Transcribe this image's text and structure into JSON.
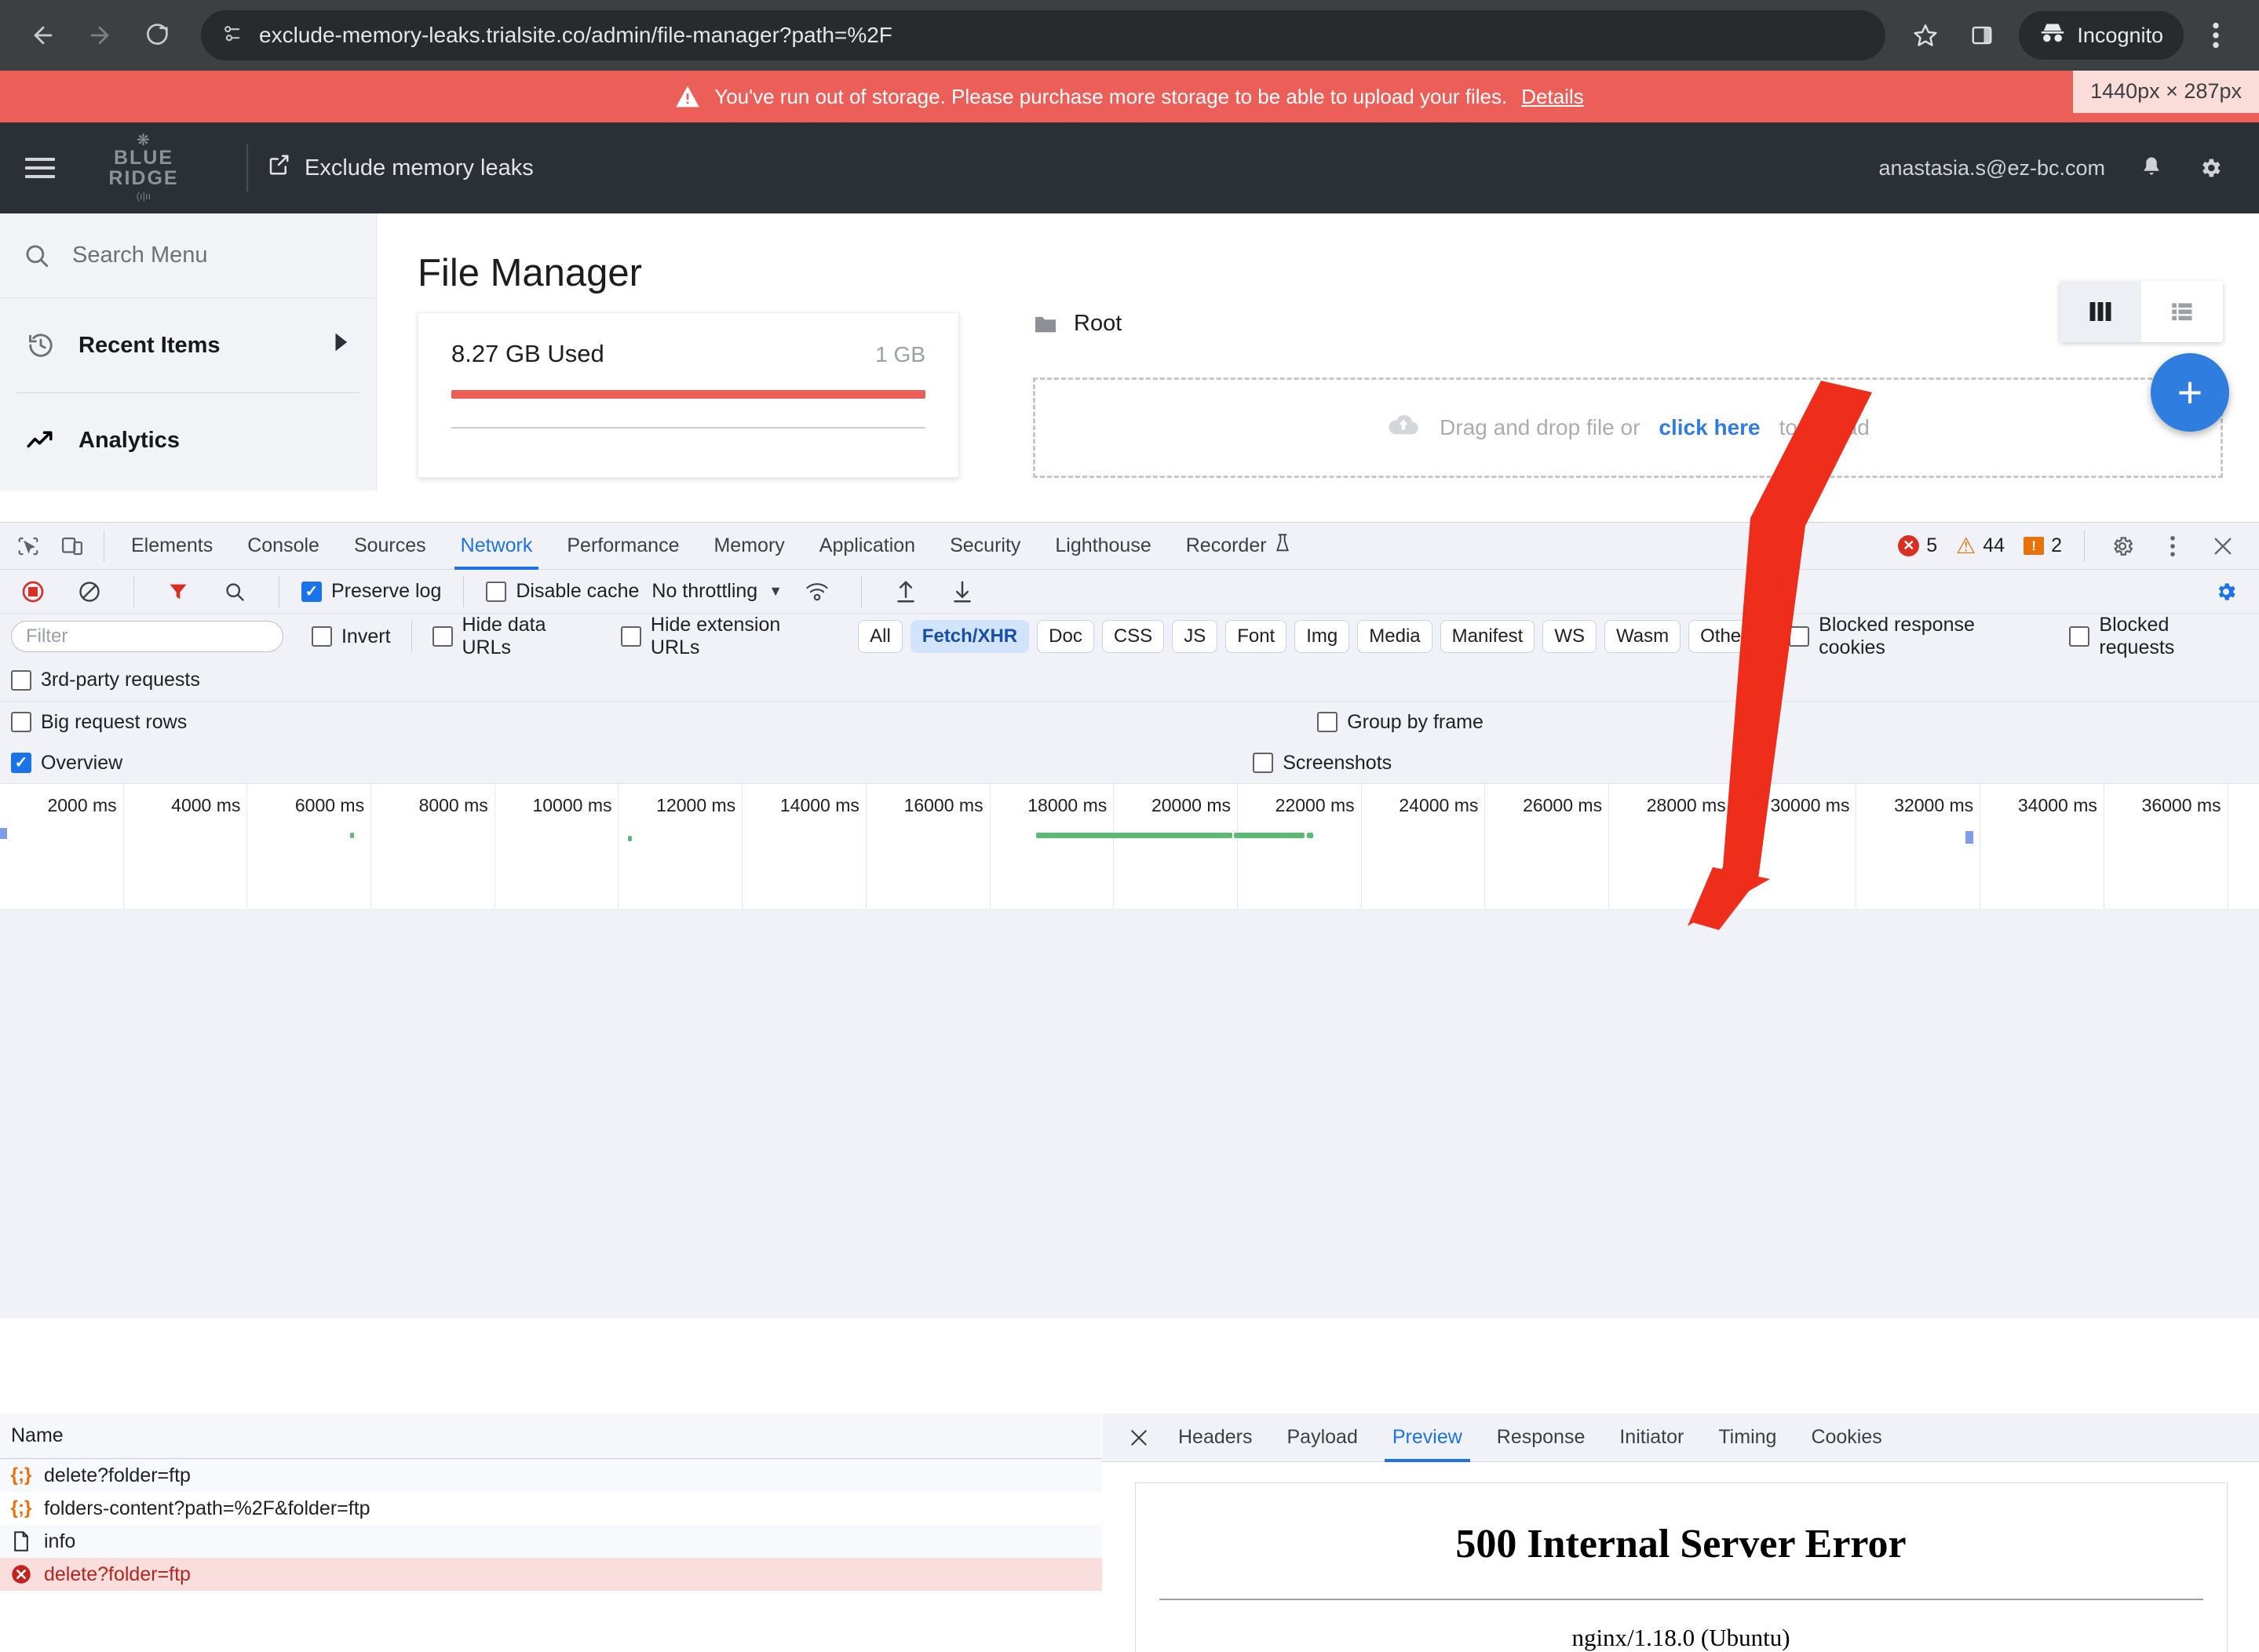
{
  "browser": {
    "url": "exclude-memory-leaks.trialsite.co/admin/file-manager?path=%2F",
    "back_label": "Back",
    "forward_label": "Forward",
    "reload_label": "Reload",
    "bookmark_label": "Bookmark this tab",
    "side_panel_label": "Side panel",
    "incognito_label": "Incognito",
    "menu_label": "Customize and control Chrome"
  },
  "storage_banner": {
    "message": "You've run out of storage. Please purchase more storage to be able to upload your files.",
    "link": "Details",
    "viewport_badge": "1440px × 287px",
    "background": "#ec5f59"
  },
  "app_header": {
    "brand_line1": "BLUE",
    "brand_line2": "RIDGE",
    "brand_sub": "(ı|ıı",
    "app_name": "Exclude memory leaks",
    "user_email": "anastasia.s@ez-bc.com"
  },
  "sidebar": {
    "search_placeholder": "Search Menu",
    "items": [
      {
        "label": "Recent Items",
        "icon": "history-icon",
        "has_caret": true
      },
      {
        "label": "Analytics",
        "icon": "trending-up-icon",
        "has_caret": false
      }
    ]
  },
  "file_manager": {
    "title": "File Manager",
    "storage": {
      "used_label": "8.27 GB Used",
      "total_label": "1 GB",
      "bar_percent": 100,
      "bar_color": "#ec5f59"
    },
    "breadcrumb": "Root",
    "dropzone": {
      "text_before": "Drag and drop file or",
      "link": "click here",
      "text_after": "to upload"
    },
    "view_grid_label": "Grid view",
    "view_list_label": "List view",
    "add_button_label": "+"
  },
  "devtools": {
    "tabs": [
      {
        "label": "Elements",
        "active": false
      },
      {
        "label": "Console",
        "active": false
      },
      {
        "label": "Sources",
        "active": false
      },
      {
        "label": "Network",
        "active": true
      },
      {
        "label": "Performance",
        "active": false
      },
      {
        "label": "Memory",
        "active": false
      },
      {
        "label": "Application",
        "active": false
      },
      {
        "label": "Security",
        "active": false
      },
      {
        "label": "Lighthouse",
        "active": false
      },
      {
        "label": "Recorder",
        "active": false
      }
    ],
    "counters": {
      "errors": "5",
      "warnings": "44",
      "infos": "2"
    },
    "settings_label": "Settings",
    "more_label": "More options",
    "close_label": "Close DevTools",
    "network_toolbar": {
      "record_label": "Stop recording network log",
      "clear_label": "Clear network log",
      "filter_label": "Filter",
      "search_label": "Search",
      "preserve_log": {
        "label": "Preserve log",
        "checked": true
      },
      "disable_cache": {
        "label": "Disable cache",
        "checked": false
      },
      "throttling": "No throttling",
      "import_label": "Import HAR file",
      "export_label": "Export HAR file",
      "network_conditions_label": "Network conditions",
      "settings_label": "Network settings"
    },
    "filter_row": {
      "filter_placeholder": "Filter",
      "invert": {
        "label": "Invert",
        "checked": false
      },
      "hide_data_urls": {
        "label": "Hide data URLs",
        "checked": false
      },
      "hide_extension_urls": {
        "label": "Hide extension URLs",
        "checked": false
      },
      "types": [
        {
          "label": "All",
          "active": false
        },
        {
          "label": "Fetch/XHR",
          "active": true
        },
        {
          "label": "Doc",
          "active": false
        },
        {
          "label": "CSS",
          "active": false
        },
        {
          "label": "JS",
          "active": false
        },
        {
          "label": "Font",
          "active": false
        },
        {
          "label": "Img",
          "active": false
        },
        {
          "label": "Media",
          "active": false
        },
        {
          "label": "Manifest",
          "active": false
        },
        {
          "label": "WS",
          "active": false
        },
        {
          "label": "Wasm",
          "active": false
        },
        {
          "label": "Other",
          "active": false
        }
      ],
      "blocked_response_cookies": {
        "label": "Blocked response cookies",
        "checked": false
      },
      "blocked_requests": {
        "label": "Blocked requests",
        "checked": false
      }
    },
    "settings_rows": {
      "third_party": {
        "label": "3rd-party requests",
        "checked": false
      },
      "big_request_rows": {
        "label": "Big request rows",
        "checked": false
      },
      "group_by_frame": {
        "label": "Group by frame",
        "checked": false
      },
      "overview": {
        "label": "Overview",
        "checked": true
      },
      "screenshots": {
        "label": "Screenshots",
        "checked": false
      }
    },
    "overview_ticks": [
      "2000 ms",
      "4000 ms",
      "6000 ms",
      "8000 ms",
      "10000 ms",
      "12000 ms",
      "14000 ms",
      "16000 ms",
      "18000 ms",
      "20000 ms",
      "22000 ms",
      "24000 ms",
      "26000 ms",
      "28000 ms",
      "30000 ms",
      "32000 ms",
      "34000 ms",
      "36000 ms"
    ],
    "requests": {
      "column_header": "Name",
      "rows": [
        {
          "name": "delete?folder=ftp",
          "icon": "json-icon",
          "error": false
        },
        {
          "name": "folders-content?path=%2F&folder=ftp",
          "icon": "json-icon",
          "error": false
        },
        {
          "name": "info",
          "icon": "document-icon",
          "error": false
        },
        {
          "name": "delete?folder=ftp",
          "icon": "error-icon",
          "error": true
        }
      ]
    },
    "detail_panel": {
      "close_label": "×",
      "tabs": [
        {
          "label": "Headers",
          "active": false
        },
        {
          "label": "Payload",
          "active": false
        },
        {
          "label": "Preview",
          "active": true
        },
        {
          "label": "Response",
          "active": false
        },
        {
          "label": "Initiator",
          "active": false
        },
        {
          "label": "Timing",
          "active": false
        },
        {
          "label": "Cookies",
          "active": false
        }
      ],
      "preview": {
        "heading": "500 Internal Server Error",
        "server": "nginx/1.18.0 (Ubuntu)"
      }
    }
  },
  "annotation": {
    "arrow_color": "#ee2d1b"
  }
}
